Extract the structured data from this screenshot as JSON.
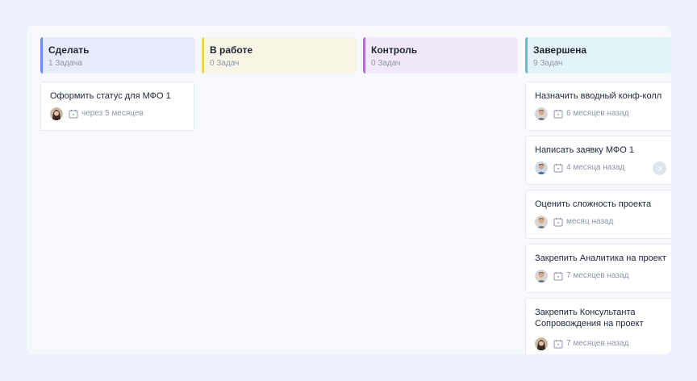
{
  "colors": {
    "page_bg": "#eef0fb",
    "board_bg": "#f8f9fd",
    "todo_accent": "#6b8fe6",
    "inprogress_accent": "#efd168",
    "control_accent": "#b96dd6",
    "done_accent": "#52c7c1"
  },
  "columns": [
    {
      "title": "Сделать",
      "count": "1 Задача",
      "cards": [
        {
          "title": "Оформить статус для МФО 1",
          "due": "через 5 месяцев",
          "avatar": "avatar-woman"
        }
      ]
    },
    {
      "title": "В работе",
      "count": "0 Задач",
      "cards": []
    },
    {
      "title": "Контроль",
      "count": "0 Задач",
      "cards": []
    },
    {
      "title": "Завершена",
      "count": "9 Задач",
      "cards": [
        {
          "title": "Назначить вводный конф-колл",
          "due": "6 месяцев назад",
          "avatar": "avatar-man"
        },
        {
          "title": "Написать заявку МФО 1",
          "due": "4 месяца назад",
          "avatar": "avatar-man-blue",
          "icon": "chevron-right-icon"
        },
        {
          "title": "Оценить сложность проекта",
          "due": "месяц назад",
          "avatar": "avatar-man"
        },
        {
          "title": "Закрепить Аналитика на проект",
          "due": "7 месяцев назад",
          "avatar": "avatar-man"
        },
        {
          "title": "Закрепить Консультанта Сопровождения на проект",
          "due": "7 месяцев назад",
          "avatar": "avatar-woman"
        }
      ]
    }
  ]
}
